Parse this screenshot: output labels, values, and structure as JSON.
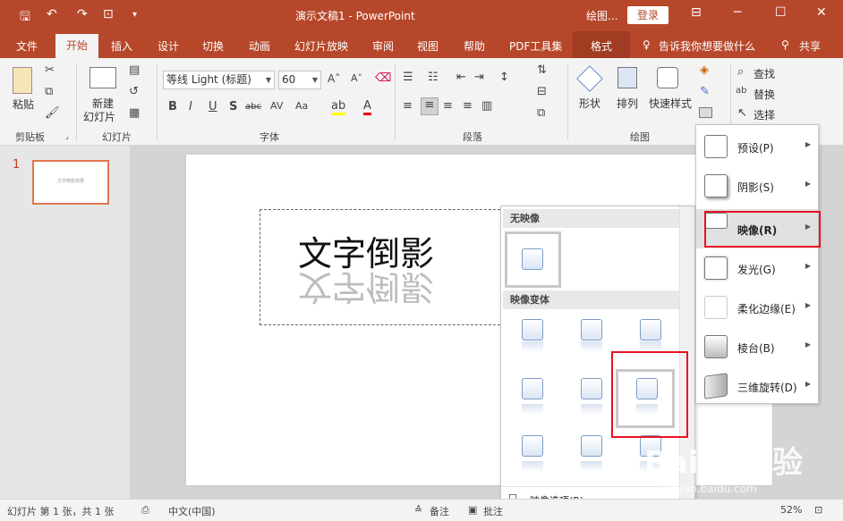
{
  "app": {
    "doc_title": "演示文稿1  -  PowerPoint",
    "context_label": "绘图...",
    "login": "登录"
  },
  "tabs": [
    "文件",
    "开始",
    "插入",
    "设计",
    "切换",
    "动画",
    "幻灯片放映",
    "审阅",
    "视图",
    "帮助",
    "PDF工具集",
    "格式"
  ],
  "tell_me": "告诉我你想要做什么",
  "share": "共享",
  "ribbon": {
    "paste": "粘贴",
    "new_slide_1": "新建",
    "new_slide_2": "幻灯片",
    "font_name": "等线 Light (标题)",
    "font_size": "60",
    "shape": "形状",
    "arrange": "排列",
    "quick_styles": "快速样式",
    "find": "查找",
    "replace": "替换",
    "select": "选择",
    "groups": {
      "clipboard": "剪贴板",
      "slides": "幻灯片",
      "font": "字体",
      "paragraph": "段落",
      "drawing": "绘图"
    }
  },
  "slides_panel": {
    "number": "1",
    "thumb_text": "文字倒影效果"
  },
  "slide": {
    "text": "文字倒影"
  },
  "gallery": {
    "header_none": "无映像",
    "header_variants": "映像变体",
    "footer_option": "映像选项(R)..."
  },
  "effects_menu": [
    {
      "label": "预设(P)",
      "icon": "preset-icon"
    },
    {
      "label": "阴影(S)",
      "icon": "shadow-icon"
    },
    {
      "label": "映像(R)",
      "icon": "reflection-icon"
    },
    {
      "label": "发光(G)",
      "icon": "glow-icon"
    },
    {
      "label": "柔化边缘(E)",
      "icon": "soft-edges-icon"
    },
    {
      "label": "棱台(B)",
      "icon": "bevel-icon"
    },
    {
      "label": "三维旋转(D)",
      "icon": "3d-rotation-icon"
    }
  ],
  "status": {
    "slide_info": "幻灯片 第 1 张，共 1 张",
    "language": "中文(中国)",
    "notes": "备注",
    "comments": "批注",
    "zoom": "52%"
  },
  "watermark": {
    "brand": "Baidu经验",
    "url": "jingyan.baidu.com"
  },
  "colors": {
    "accent": "#b7472a",
    "highlight_box": "#e81123"
  }
}
